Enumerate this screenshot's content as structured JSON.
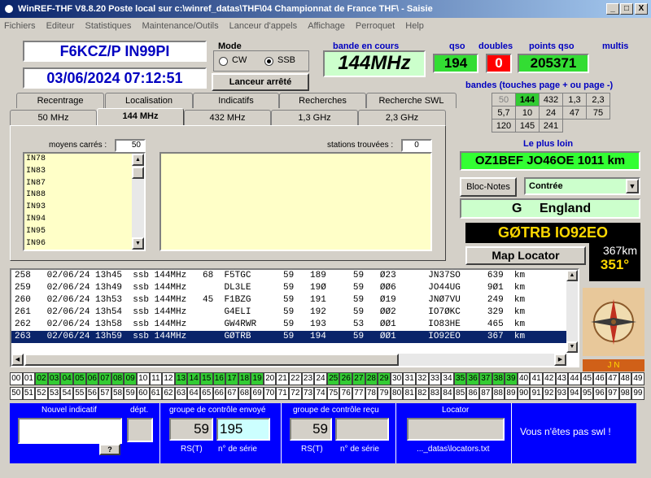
{
  "titlebar": {
    "title": "WinREF-THF V8.8.20 Poste local sur c:\\winref_datas\\THF\\04 Championnat de France THF\\ -   Saisie",
    "min": "_",
    "max": "□",
    "close": "X"
  },
  "menu": [
    "Fichiers",
    "Editeur",
    "Statistiques",
    "Maintenance/Outils",
    "Lanceur d'appels",
    "Affichage",
    "Perroquet",
    "Help"
  ],
  "station": {
    "callsign_locator": "F6KCZ/P  IN99PI",
    "datetime": "03/06/2024   07:12:51"
  },
  "mode": {
    "title": "Mode",
    "cw": "CW",
    "ssb": "SSB",
    "selected": "SSB"
  },
  "launcher": "Lanceur arrêté",
  "bande_en_cours": {
    "label": "bande en cours",
    "value": "144MHz"
  },
  "qso": {
    "label": "qso",
    "value": "194"
  },
  "doubles": {
    "label": "doubles",
    "value": "0"
  },
  "points": {
    "label": "points qso",
    "value": "205371"
  },
  "multis": {
    "label": "multis"
  },
  "bandes": {
    "title": "bandes (touches page + ou page -)",
    "rows": [
      [
        "50",
        "144",
        "432",
        "1,3",
        "2,3"
      ],
      [
        "5,7",
        "10",
        "24",
        "47",
        "75"
      ],
      [
        "120",
        "145",
        "241",
        "",
        ""
      ]
    ],
    "active": "144"
  },
  "le_plus_loin": {
    "label": "Le plus loin",
    "value": "OZ1BEF JO46OE  1011 km"
  },
  "bloc_notes": "Bloc-Notes",
  "contree": {
    "selected": "Contrée"
  },
  "country": {
    "prefix": "G",
    "name": "England"
  },
  "current": {
    "call_loc": "GØTRB   IO92EO",
    "dist": "367km",
    "bearing": "351°"
  },
  "map_locator": "Map Locator",
  "compass_label": "J N",
  "tabs_row1": [
    "Recentrage",
    "Localisation",
    "Indicatifs",
    "Recherches",
    "Recherche SWL"
  ],
  "tabs_row2": [
    "50 MHz",
    "144 MHz",
    "432 MHz",
    "1,3 GHz",
    "2,3 GHz"
  ],
  "active_tab": "144 MHz",
  "moyens": {
    "label": "moyens carrés :",
    "value": "50",
    "items": [
      "IN78",
      "IN83",
      "IN87",
      "IN88",
      "IN93",
      "IN94",
      "IN95",
      "IN96"
    ]
  },
  "stations": {
    "label": "stations trouvées :",
    "value": "0"
  },
  "log": [
    "258   02/06/24 13h45  ssb 144MHz   68  F5TGC      59   189     59   Ø23      JN37SO     639  km",
    "259   02/06/24 13h49  ssb 144MHz       DL3LE      59   19Ø     59   ØØ6      JO44UG     9Ø1  km",
    "260   02/06/24 13h53  ssb 144MHz   45  F1BZG      59   191     59   Ø19      JNØ7VU     249  km",
    "261   02/06/24 13h54  ssb 144MHz       G4ELI      59   192     59   ØØ2      IO7ØKC     329  km",
    "262   02/06/24 13h58  ssb 144MHz       GW4RWR     59   193     53   ØØ1      IO83HE     465  km",
    "263   02/06/24 13h59  ssb 144MHz       GØTRB      59   194     59   ØØ1      IO92EO     367  km"
  ],
  "numbers_row1": [
    "00",
    "01",
    "02",
    "03",
    "04",
    "05",
    "06",
    "07",
    "08",
    "09",
    "10",
    "11",
    "12",
    "13",
    "14",
    "15",
    "16",
    "17",
    "18",
    "19",
    "20",
    "21",
    "22",
    "23",
    "24",
    "25",
    "26",
    "27",
    "28",
    "29",
    "30",
    "31",
    "32",
    "33",
    "34",
    "35",
    "36",
    "37",
    "38",
    "39",
    "40",
    "41",
    "42",
    "43",
    "44",
    "45",
    "46",
    "47",
    "48",
    "49"
  ],
  "numbers_row2": [
    "50",
    "51",
    "52",
    "53",
    "54",
    "55",
    "56",
    "57",
    "58",
    "59",
    "60",
    "61",
    "62",
    "63",
    "64",
    "65",
    "66",
    "67",
    "68",
    "69",
    "70",
    "71",
    "72",
    "73",
    "74",
    "75",
    "76",
    "77",
    "78",
    "79",
    "80",
    "81",
    "82",
    "83",
    "84",
    "85",
    "86",
    "87",
    "88",
    "89",
    "90",
    "91",
    "92",
    "93",
    "94",
    "95",
    "96",
    "97",
    "98",
    "99"
  ],
  "green_numbers": [
    "02",
    "03",
    "04",
    "05",
    "06",
    "07",
    "08",
    "09",
    "13",
    "14",
    "15",
    "16",
    "17",
    "18",
    "19",
    "25",
    "26",
    "27",
    "28",
    "29",
    "35",
    "36",
    "37",
    "38",
    "39"
  ],
  "bottom": {
    "nouvel_indicatif": "Nouvel indicatif",
    "dept": "dépt.",
    "help_btn": "?",
    "groupe_envoye": "groupe de contrôle envoyé",
    "rst_sent": "59",
    "serie_sent": "195",
    "rst_label": "RS(T)",
    "serie_label": "n° de série",
    "groupe_recu": "groupe de contrôle reçu",
    "rst_recv": "59",
    "locator": "Locator",
    "loc_file": "..._datas\\locators.txt",
    "swl": "Vous n'êtes pas swl !"
  }
}
